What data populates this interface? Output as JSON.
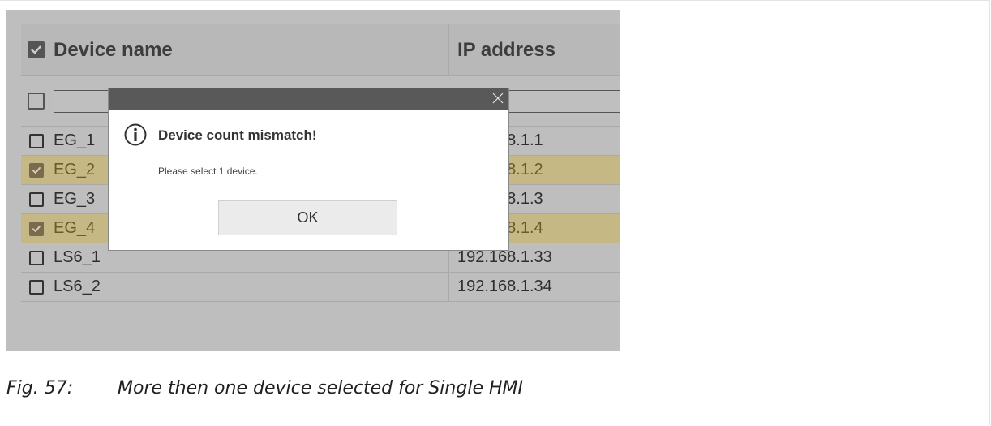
{
  "table": {
    "headers": {
      "device_name": "Device name",
      "ip_address": "IP address"
    },
    "header_checked": true,
    "rows": [
      {
        "name": "EG_1",
        "ip": "192.168.1.1",
        "checked": false
      },
      {
        "name": "EG_2",
        "ip": "192.168.1.2",
        "checked": true
      },
      {
        "name": "EG_3",
        "ip": "192.168.1.3",
        "checked": false
      },
      {
        "name": "EG_4",
        "ip": "192.168.1.4",
        "checked": true
      },
      {
        "name": "LS6_1",
        "ip": "192.168.1.33",
        "checked": false
      },
      {
        "name": "LS6_2",
        "ip": "192.168.1.34",
        "checked": false
      }
    ],
    "filter": {
      "name_value": "",
      "ip_value": ""
    }
  },
  "dialog": {
    "title": "Device count mismatch!",
    "message": "Please select 1 device.",
    "ok_label": "OK",
    "close_glyph": "×",
    "icon": "info-icon"
  },
  "caption": {
    "number": "Fig. 57:",
    "text": "More then one device selected for Single HMI"
  },
  "colors": {
    "overlay_gray": "#bebebe",
    "selected_row": "#c6b885",
    "dialog_titlebar": "#595959"
  }
}
